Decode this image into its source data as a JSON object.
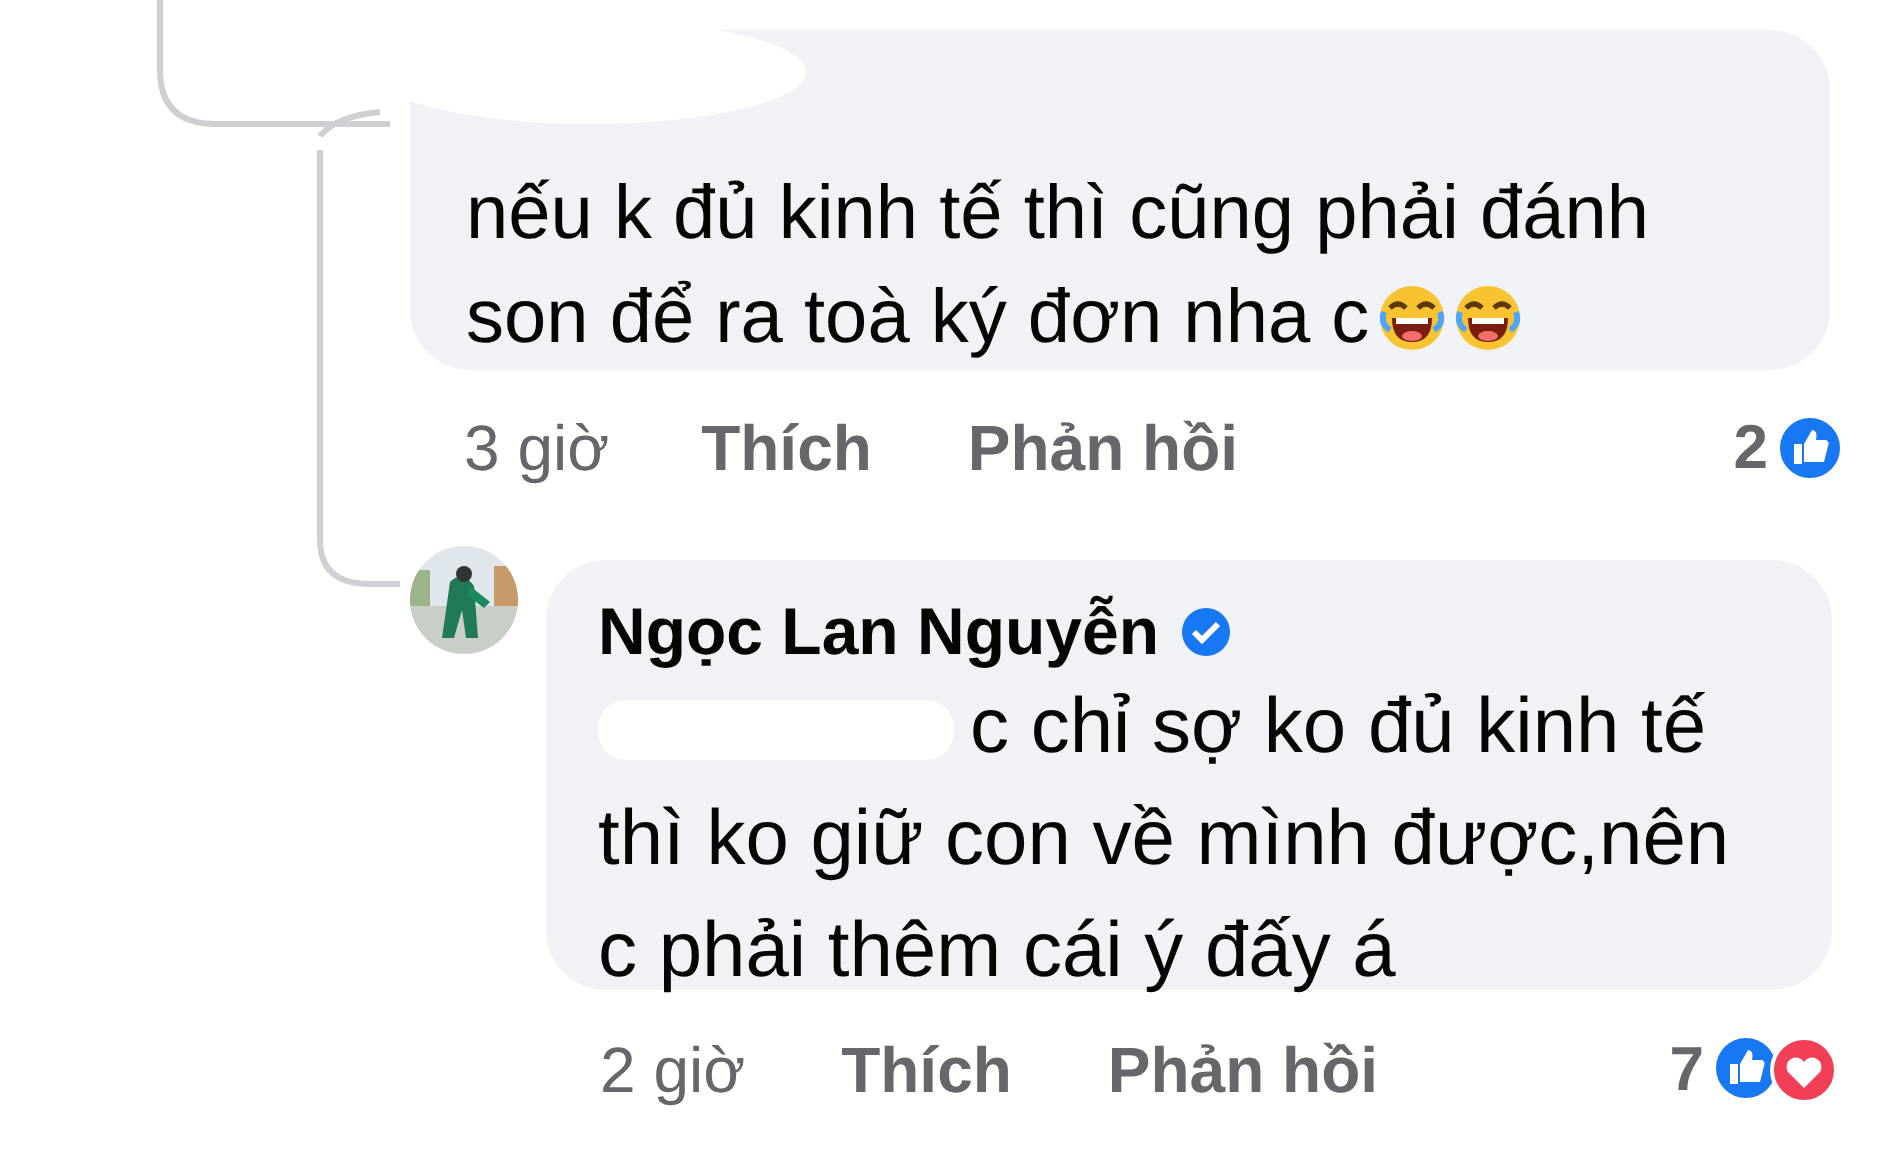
{
  "comments": [
    {
      "text": "nếu k đủ kinh tế thì cũng phải đánh son để ra toà ký đơn nha c",
      "emojis": [
        {
          "kind": "laugh"
        },
        {
          "kind": "laugh"
        }
      ],
      "time": "3 giờ",
      "like_label": "Thích",
      "reply_label": "Phản hồi",
      "reaction_count": "2",
      "reactions": [
        {
          "kind": "like"
        }
      ]
    },
    {
      "author": "Ngọc Lan Nguyễn",
      "verified": true,
      "mention_hidden": true,
      "text": "c chỉ sợ ko đủ kinh tế thì ko giữ con về mình được,nên c phải thêm cái ý đấy á",
      "time": "2 giờ",
      "like_label": "Thích",
      "reply_label": "Phản hồi",
      "reaction_count": "7",
      "reactions": [
        {
          "kind": "like"
        },
        {
          "kind": "love"
        }
      ]
    }
  ]
}
